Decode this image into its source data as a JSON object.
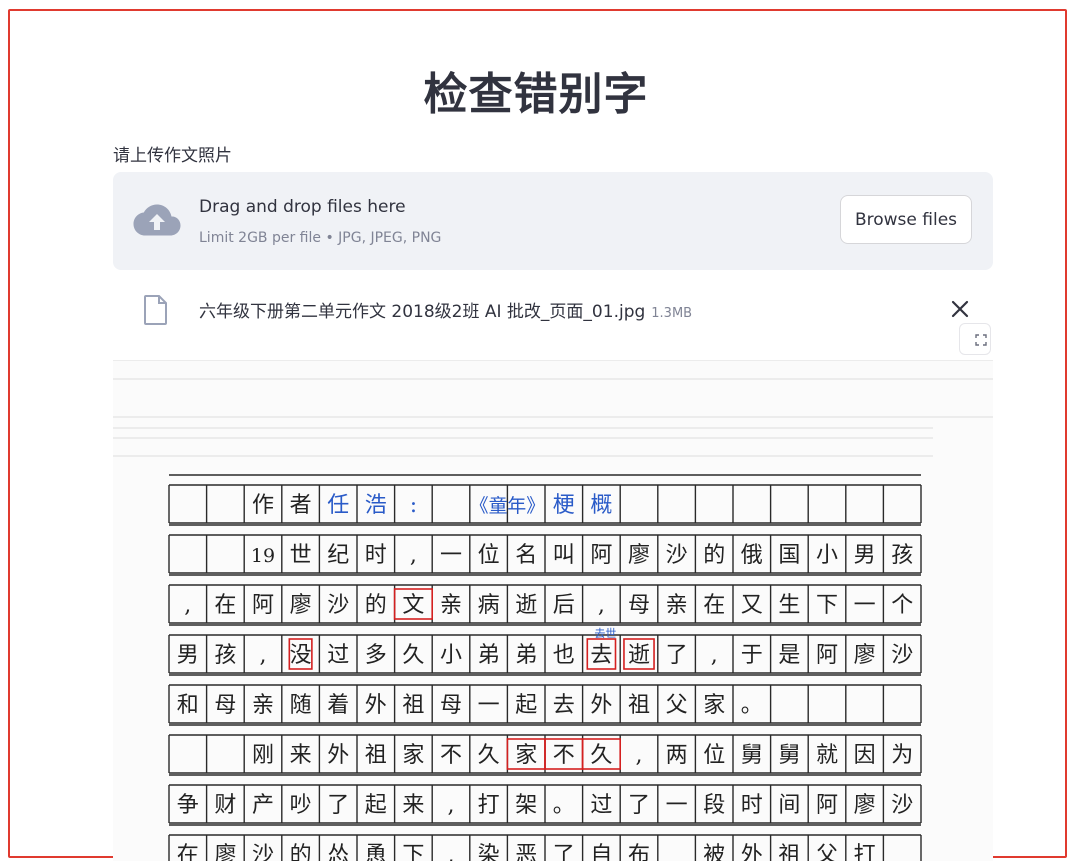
{
  "page": {
    "title": "检查错别字",
    "upload_label": "请上传作文照片"
  },
  "dropzone": {
    "title": "Drag and drop files here",
    "subtitle": "Limit 2GB per file • JPG, JPEG, PNG",
    "browse_label": "Browse files",
    "icon": "cloud-upload-icon"
  },
  "uploaded_file": {
    "name": "六年级下册第二单元作文 2018级2班 AI 批改_页面_01.jpg",
    "size": "1.3MB",
    "icon": "file-icon",
    "remove_icon": "close-icon"
  },
  "image_viewer": {
    "fullscreen_icon": "fullscreen-icon"
  },
  "essay": {
    "rows": [
      [
        "",
        "",
        "作",
        "者",
        "任",
        "浩",
        ":",
        "",
        "《童",
        "年》",
        "梗",
        "概",
        "",
        "",
        "",
        "",
        "",
        "",
        ""
      ],
      [
        "",
        "",
        "19",
        "世",
        "纪",
        "时",
        ",",
        "一",
        "位",
        "名",
        "叫",
        "阿",
        "廖",
        "沙",
        "的",
        "俄",
        "国",
        "小",
        "男",
        "孩"
      ],
      [
        ",",
        "在",
        "阿",
        "廖",
        "沙",
        "的",
        "文",
        "亲",
        "病",
        "逝",
        "后",
        ",",
        "母",
        "亲",
        "在",
        "又",
        "生",
        "下",
        "一",
        "个"
      ],
      [
        "男",
        "孩",
        ",",
        "没",
        "过",
        "多",
        "久",
        "小",
        "弟",
        "弟",
        "也",
        "去",
        "逝",
        "了",
        ",",
        "于",
        "是",
        "阿",
        "廖",
        "沙"
      ],
      [
        "和",
        "母",
        "亲",
        "随",
        "着",
        "外",
        "祖",
        "母",
        "一",
        "起",
        "去",
        "外",
        "祖",
        "父",
        "家",
        "。",
        "",
        "",
        "",
        ""
      ],
      [
        "",
        "",
        "刚",
        "来",
        "外",
        "祖",
        "家",
        "不",
        "久",
        "家",
        "不",
        "久",
        ",",
        "两",
        "位",
        "舅",
        "舅",
        "就",
        "因",
        "为"
      ],
      [
        "争",
        "财",
        "产",
        "吵",
        "了",
        "起",
        "来",
        ",",
        "打",
        "架",
        "。",
        "过",
        "了",
        "一",
        "段",
        "时",
        "间",
        "阿",
        "廖",
        "沙"
      ],
      [
        "在",
        "廖",
        "沙",
        "的",
        "怂",
        "恿",
        "下",
        ",",
        "染",
        "恶",
        "了",
        "自",
        "布",
        "",
        "被",
        "外",
        "祖",
        "父",
        "打",
        ""
      ]
    ],
    "correction_note": "去世",
    "ink_blue": "#2a5bc8",
    "ink_black": "#222222",
    "mark_red": "#d42020"
  }
}
